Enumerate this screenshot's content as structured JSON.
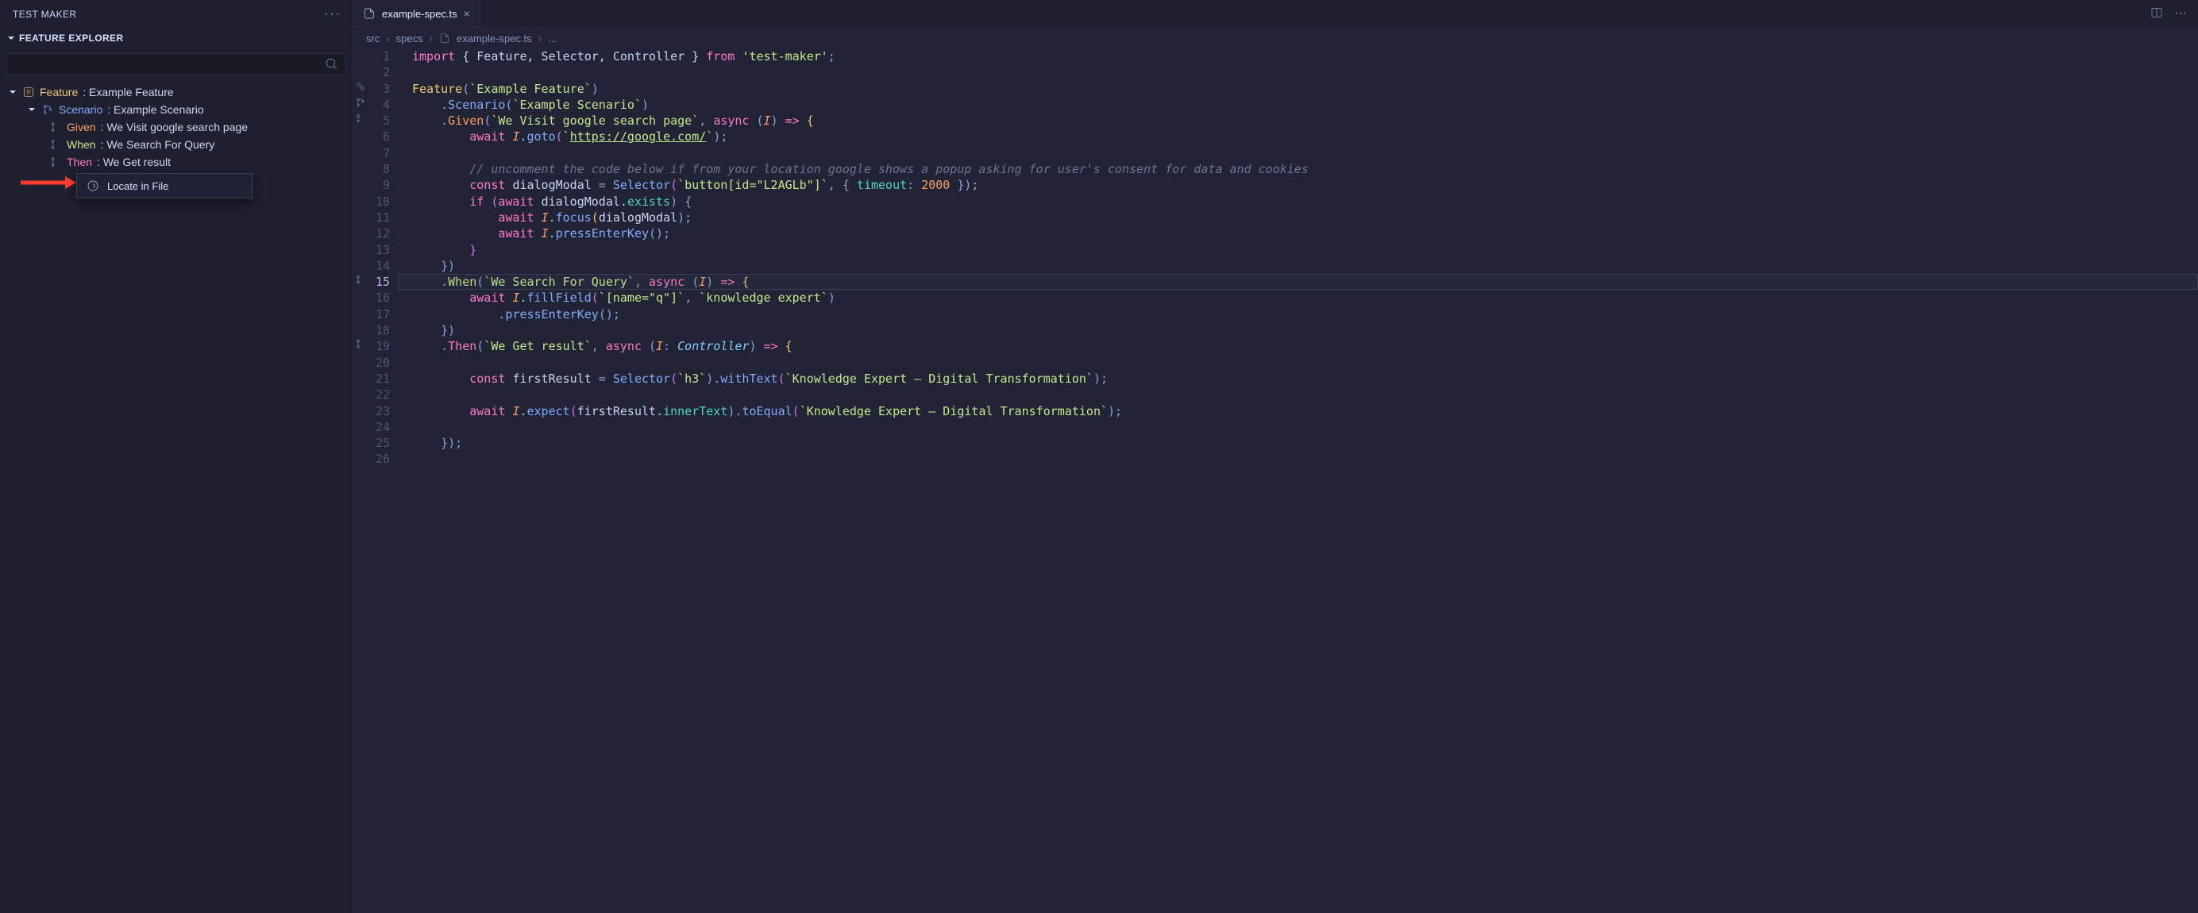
{
  "sidebar": {
    "title": "TEST MAKER",
    "section": "FEATURE EXPLORER",
    "search_placeholder": ""
  },
  "tree": {
    "feature_kw": "Feature",
    "feature_name": ": Example Feature",
    "scenario_kw": "Scenario",
    "scenario_name": ": Example Scenario",
    "given_kw": "Given",
    "given_name": ": We Visit google search page",
    "when_kw": "When",
    "when_name": ": We Search For Query",
    "then_kw": "Then",
    "then_name": ": We Get result"
  },
  "context_menu": {
    "locate": "Locate in File"
  },
  "tab": {
    "filename": "example-spec.ts"
  },
  "breadcrumbs": {
    "p0": "src",
    "p1": "specs",
    "p2": "example-spec.ts",
    "p3": "..."
  },
  "code": {
    "l1_a": "import",
    "l1_b": " { Feature, Selector, Controller } ",
    "l1_c": "from",
    "l1_d": " 'test-maker'",
    "l1_e": ";",
    "l3_a": "Feature",
    "l3_b": "(",
    "l3_c": "`Example Feature`",
    "l3_d": ")",
    "l4_a": "    .",
    "l4_b": "Scenario",
    "l4_c": "(",
    "l4_d": "`Example Scenario`",
    "l4_e": ")",
    "l5_a": "    .",
    "l5_b": "Given",
    "l5_c": "(",
    "l5_d": "`We Visit google search page`",
    "l5_e": ", ",
    "l5_f": "async",
    "l5_g": " (",
    "l5_h": "I",
    "l5_i": ") ",
    "l5_j": "=>",
    "l5_k": " {",
    "l6_a": "        await ",
    "l6_b": "I",
    "l6_c": ".",
    "l6_d": "goto",
    "l6_e": "(",
    "l6_f": "`",
    "l6_g": "https://google.com/",
    "l6_h": "`",
    "l6_i": ");",
    "l8_a": "        // uncomment the code below if from your location google shows a popup asking for user's consent for data and cookies",
    "l9_a": "        const ",
    "l9_b": "dialogModal",
    "l9_c": " = ",
    "l9_d": "Selector",
    "l9_e": "(",
    "l9_f": "`button[id=\"L2AGLb\"]`",
    "l9_g": ", { ",
    "l9_h": "timeout",
    "l9_i": ": ",
    "l9_j": "2000",
    "l9_k": " });",
    "l10_a": "        if ",
    "l10_b": "(",
    "l10_c": "await ",
    "l10_d": "dialogModal",
    "l10_e": ".",
    "l10_f": "exists",
    "l10_g": ") {",
    "l11_a": "            await ",
    "l11_b": "I",
    "l11_c": ".",
    "l11_d": "focus",
    "l11_e": "(",
    "l11_f": "dialogModal",
    "l11_g": ");",
    "l12_a": "            await ",
    "l12_b": "I",
    "l12_c": ".",
    "l12_d": "pressEnterKey",
    "l12_e": "();",
    "l13_a": "        }",
    "l14_a": "    })",
    "l15_a": "    .",
    "l15_b": "When",
    "l15_c": "(",
    "l15_d": "`We Search For Query`",
    "l15_e": ", ",
    "l15_f": "async",
    "l15_g": " (",
    "l15_h": "I",
    "l15_i": ") ",
    "l15_j": "=>",
    "l15_k": " {",
    "l16_a": "        await ",
    "l16_b": "I",
    "l16_c": ".",
    "l16_d": "fillField",
    "l16_e": "(",
    "l16_f": "`[name=\"q\"]`",
    "l16_g": ", ",
    "l16_h": "`knowledge expert`",
    "l16_i": ")",
    "l17_a": "            .",
    "l17_b": "pressEnterKey",
    "l17_c": "();",
    "l18_a": "    })",
    "l19_a": "    .",
    "l19_b": "Then",
    "l19_c": "(",
    "l19_d": "`We Get result`",
    "l19_e": ", ",
    "l19_f": "async",
    "l19_g": " (",
    "l19_h": "I",
    "l19_i": ": ",
    "l19_j": "Controller",
    "l19_k": ") ",
    "l19_l": "=>",
    "l19_m": " {",
    "l21_a": "        const ",
    "l21_b": "firstResult",
    "l21_c": " = ",
    "l21_d": "Selector",
    "l21_e": "(",
    "l21_f": "`h3`",
    "l21_g": ").",
    "l21_h": "withText",
    "l21_i": "(",
    "l21_j": "`Knowledge Expert – Digital Transformation`",
    "l21_k": ");",
    "l23_a": "        await ",
    "l23_b": "I",
    "l23_c": ".",
    "l23_d": "expect",
    "l23_e": "(",
    "l23_f": "firstResult",
    "l23_g": ".",
    "l23_h": "innerText",
    "l23_i": ").",
    "l23_j": "toEqual",
    "l23_k": "(",
    "l23_l": "`Knowledge Expert – Digital Transformation`",
    "l23_m": ");",
    "l25_a": "    });"
  },
  "line_numbers": [
    "1",
    "2",
    "3",
    "4",
    "5",
    "6",
    "7",
    "8",
    "9",
    "10",
    "11",
    "12",
    "13",
    "14",
    "15",
    "16",
    "17",
    "18",
    "19",
    "20",
    "21",
    "22",
    "23",
    "24",
    "25",
    "26"
  ],
  "active_line_index": 14
}
